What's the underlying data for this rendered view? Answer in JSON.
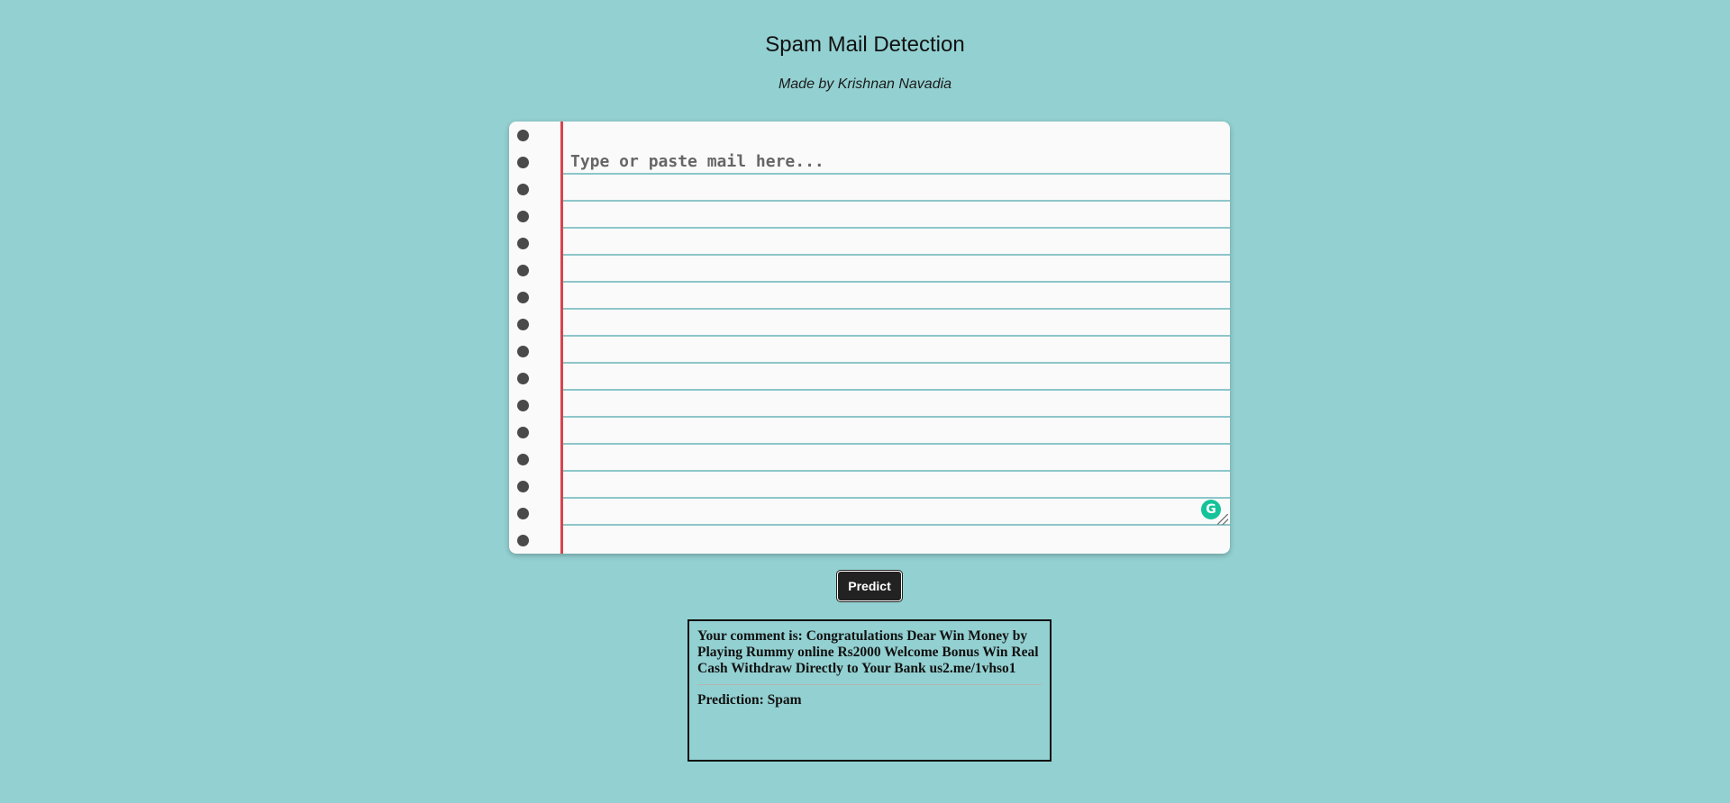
{
  "header": {
    "title": "Spam Mail Detection",
    "subtitle": "Made by Krishnan Navadia"
  },
  "editor": {
    "placeholder": "Type or paste mail here...",
    "value": ""
  },
  "predict_button": {
    "label": "Predict"
  },
  "result": {
    "comment_label": "Your comment is:",
    "comment_text": "Congratulations Dear Win Money by Playing Rummy online Rs2000 Welcome Bonus Win Real Cash Withdraw Directly to Your Bank us2.me/1vhso1",
    "prediction_label": "Prediction:",
    "prediction_value": "Spam"
  },
  "colors": {
    "background": "#93d0d1",
    "paper": "#fafafa",
    "margin_line": "#d8434e",
    "ruled_line": "#8dc6c9",
    "button": "#222222",
    "grammarly": "#15c39a"
  },
  "icons": {
    "grammarly": "grammarly-icon",
    "resize": "resize-grip-icon"
  }
}
